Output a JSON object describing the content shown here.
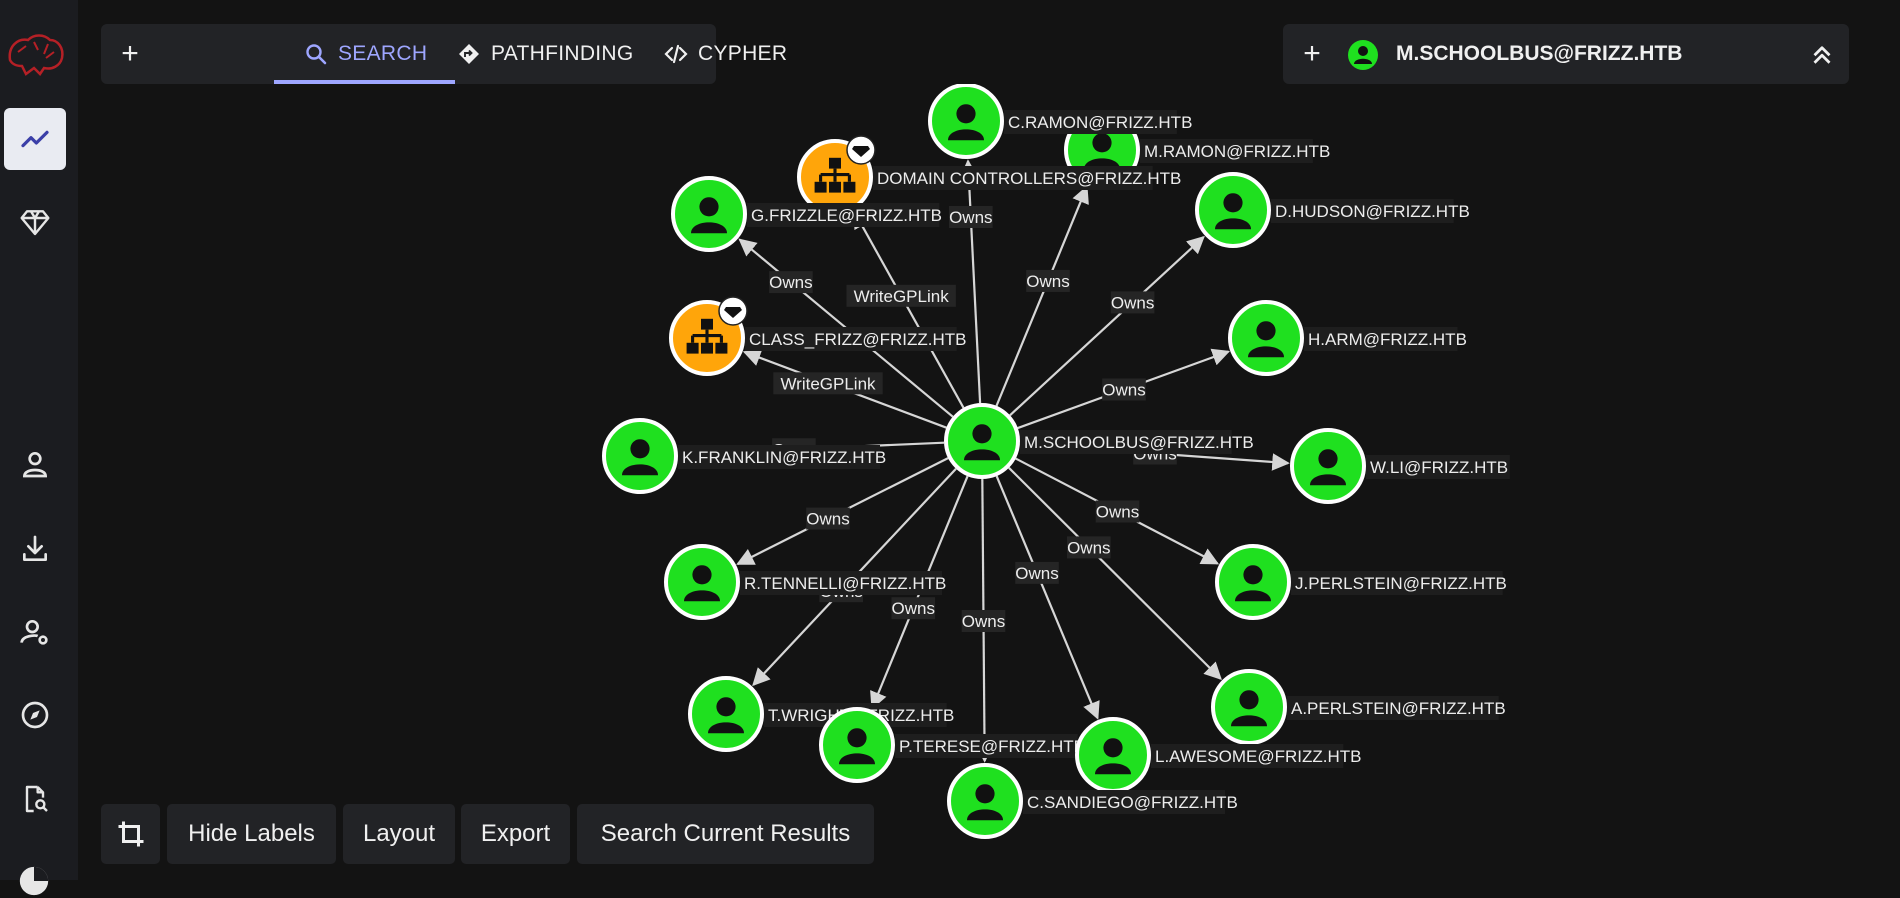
{
  "sidebar": {
    "items": [
      {
        "name": "explore",
        "icon": "line-chart-icon",
        "active": true
      },
      {
        "name": "zones",
        "icon": "gem-icon",
        "active": false
      },
      {
        "name": "users",
        "icon": "user-icon",
        "active": false
      },
      {
        "name": "download",
        "icon": "download-icon",
        "active": false
      },
      {
        "name": "admin",
        "icon": "user-cog-icon",
        "active": false
      },
      {
        "name": "explore-compass",
        "icon": "compass-icon",
        "active": false
      },
      {
        "name": "file-search",
        "icon": "file-search-icon",
        "active": false
      }
    ]
  },
  "topbar": {
    "add_label": "+",
    "tabs": [
      {
        "label": "SEARCH",
        "icon": "search-icon",
        "active": true
      },
      {
        "label": "PATHFINDING",
        "icon": "directions-icon",
        "active": false
      },
      {
        "label": "CYPHER",
        "icon": "code-icon",
        "active": false
      }
    ]
  },
  "selected_node": {
    "add_label": "+",
    "label": "M.SCHOOLBUS@FRIZZ.HTB"
  },
  "bottom_toolbar": {
    "hide_labels": "Hide Labels",
    "layout": "Layout",
    "export": "Export",
    "search_results": "Search Current Results"
  },
  "colors": {
    "user": "#1fe01f",
    "group": "#ffa50a",
    "accent": "#9ea6ff",
    "edge": "#d6d6d6"
  },
  "graph": {
    "center": {
      "id": "center",
      "label": "M.SCHOOLBUS@FRIZZ.HTB",
      "type": "user"
    },
    "nodes": [
      {
        "id": "m_ramon",
        "label": "M.RAMON@FRIZZ.HTB",
        "type": "user"
      },
      {
        "id": "c_ramon",
        "label": "C.RAMON@FRIZZ.HTB",
        "type": "user"
      },
      {
        "id": "dc",
        "label": "DOMAIN CONTROLLERS@FRIZZ.HTB",
        "type": "group",
        "tier_zero": true
      },
      {
        "id": "g_frizzle",
        "label": "G.FRIZZLE@FRIZZ.HTB",
        "type": "user"
      },
      {
        "id": "d_hudson",
        "label": "D.HUDSON@FRIZZ.HTB",
        "type": "user"
      },
      {
        "id": "class_frizz",
        "label": "CLASS_FRIZZ@FRIZZ.HTB",
        "type": "group",
        "tier_zero": true
      },
      {
        "id": "h_arm",
        "label": "H.ARM@FRIZZ.HTB",
        "type": "user"
      },
      {
        "id": "k_franklin",
        "label": "K.FRANKLIN@FRIZZ.HTB",
        "type": "user"
      },
      {
        "id": "w_li",
        "label": "W.LI@FRIZZ.HTB",
        "type": "user"
      },
      {
        "id": "r_tennelli",
        "label": "R.TENNELLI@FRIZZ.HTB",
        "type": "user"
      },
      {
        "id": "j_perlstein",
        "label": "J.PERLSTEIN@FRIZZ.HTB",
        "type": "user"
      },
      {
        "id": "a_perlstein",
        "label": "A.PERLSTEIN@FRIZZ.HTB",
        "type": "user"
      },
      {
        "id": "t_wright",
        "label": "T.WRIGHT@FRIZZ.HTB",
        "type": "user"
      },
      {
        "id": "p_terese",
        "label": "P.TERESE@FRIZZ.HTB",
        "type": "user"
      },
      {
        "id": "l_awesome",
        "label": "L.AWESOME@FRIZZ.HTB",
        "type": "user"
      },
      {
        "id": "c_sandiego",
        "label": "C.SANDIEGO@FRIZZ.HTB",
        "type": "user"
      }
    ],
    "edges": [
      {
        "to": "m_ramon",
        "label": "Owns"
      },
      {
        "to": "c_ramon",
        "label": "Owns"
      },
      {
        "to": "dc",
        "label": "WriteGPLink"
      },
      {
        "to": "g_frizzle",
        "label": "Owns"
      },
      {
        "to": "d_hudson",
        "label": "Owns"
      },
      {
        "to": "class_frizz",
        "label": "WriteGPLink"
      },
      {
        "to": "h_arm",
        "label": "Owns"
      },
      {
        "to": "k_franklin",
        "label": "Owns"
      },
      {
        "to": "w_li",
        "label": "Owns"
      },
      {
        "to": "r_tennelli",
        "label": "Owns"
      },
      {
        "to": "j_perlstein",
        "label": "Owns"
      },
      {
        "to": "a_perlstein",
        "label": "Owns"
      },
      {
        "to": "t_wright",
        "label": "Owns"
      },
      {
        "to": "p_terese",
        "label": "Owns"
      },
      {
        "to": "l_awesome",
        "label": "Owns"
      },
      {
        "to": "c_sandiego",
        "label": "Owns"
      }
    ]
  }
}
